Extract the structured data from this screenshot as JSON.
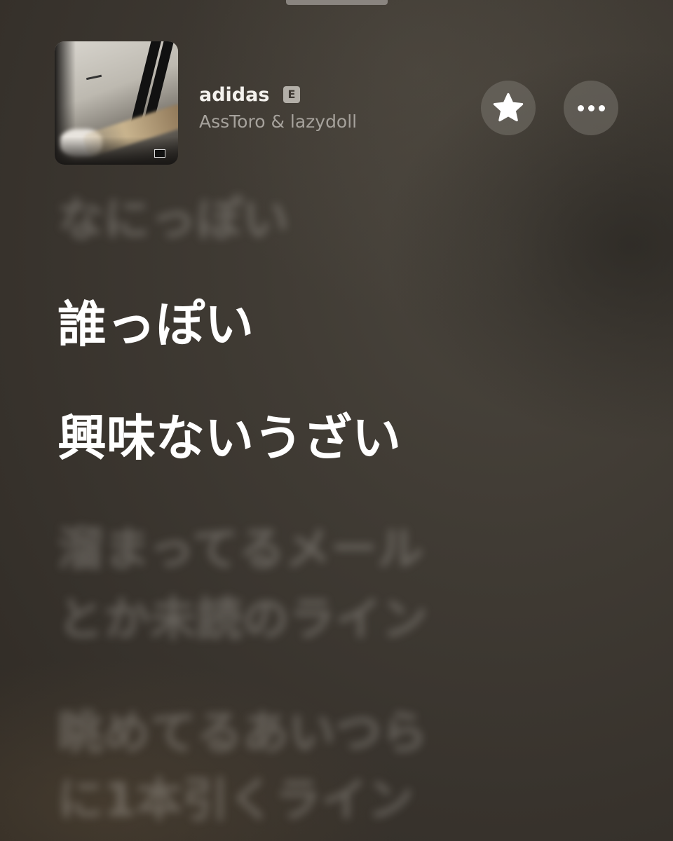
{
  "track": {
    "title": "adidas",
    "explicit_badge": "E",
    "artist": "AssToro & lazydoll"
  },
  "controls": {
    "favorite_icon": "star-icon",
    "more_icon": "ellipsis-icon"
  },
  "lyrics": {
    "previous_line": "なにっぽい",
    "current_lines": [
      "誰っぽい",
      "興味ないうざい"
    ],
    "next_lines": [
      "溜まってるメール",
      "とか未読のライン",
      "眺めてるあいつら",
      "に1本引くライン"
    ]
  },
  "colors": {
    "background": "#3e3933",
    "active_lyric": "#ffffff",
    "secondary_text": "#a6a29c"
  }
}
